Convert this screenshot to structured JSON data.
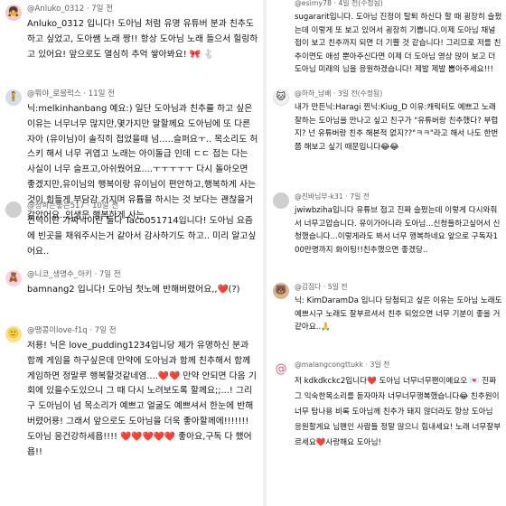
{
  "left_column": {
    "comments": [
      {
        "author": "@Anluko_0312",
        "time": "7일 전",
        "avatar_icon": "girl-avatar-icon",
        "text": "Anluko_0312 입니다! 도아님 처럼 유명 유튜버 분과 친추도 하고 싶었고, 도아쌤 노래 짱!! 항상 도아님 노래 들으서 힐링하고 있어요! 앞으로도 열심히 추억 쌓아봐요! 🎀 🐇"
      },
      {
        "author": "@뭐야_로블럭스",
        "time": "11일 전",
        "avatar_icon": "character-avatar-icon",
        "text": "닉:melkinhanbang 예요:) 일단 도아님과 친추를 하고 싶은 이유는 너무너무 많지만,몇가지만 말할께요 도아님에 또 다른 자아 (유이님)이 솔직히 접었을때 넘.....슬퍼요ㅜ.. 목소리도 허스키 해서 너무 귀엽고 노래는 아이돌급 인데 ㄷㄷ 접는 다는 사실이 너무 슬프고,아쉬웠어요....ㅜㅜㅜㅜㅜ 다시 돌아오면 좋겠지만,유이님의 행복이랑 유이님이 편안하고,행복하게 사는 것이 힘들게 부담감 가지며 유튭을 하시는 것 보다는 괜찮을거 같았어요..인생은 행복하게 사는"
      },
      {
        "author": "@정희는좋은517",
        "time": "10일 전",
        "avatar_icon": "gray-avatar-icon",
        "text": "찐닉이란 가짜닉이란 둘다 Taco051714입니다! 도아님 요즘에 빈곳을 채워주시는거 같아서 감사하기도 하고.. 미리 알고싶어요.."
      },
      {
        "author": "@니코_생명수_아키",
        "time": "7일 전",
        "avatar_icon": "pink-character-avatar-icon",
        "text": "bamnang2 입니다! 도아님 첫노에 반해버렸어요,,❤️(?)"
      },
      {
        "author": "@땡콩이love-f1q",
        "time": "7일 전",
        "avatar_icon": "shinchan-avatar-icon",
        "text": "저용! 닉은 love_pudding1234입니당 제가 유명하신 분과 함께 게임을 하구싶은데 만약에 도아님과 함께 친추해서 함께 게임하면 정말루 행복할것같네염....❤️❤️ 만약 안되면 다음 기회에 있을수도있으니 그 때 다시 노려보도록 할께요;;...! 그리구 도아님이 넘 목소리가 예쁘고 얼굴도 예쁘셔서 한눈에 반해버렸어용! 그래서 앞으로도 도아님을 더욱 좋아할께에!!!!!!! 도아님 응건강하세욥!!!! ❤️❤️❤️❤️❤️ 좋아요,구독 다 했어욥!!"
      }
    ]
  },
  "right_column": {
    "comments": [
      {
        "author": "@esimy78",
        "time": "4일 전(수정됨)",
        "avatar_icon": "none",
        "text": "sugararit입니다. 도아님 진정이 탈퇴 하신다 할 때 굉장히 슬펐는데 이렇게 또 보고 있어서 굉장히 기쁩니다.이제 도아님 채널 접이 보고 친추까지 되면 더 기쁠 것 같습니다! 그리므로 저를 친추이면도 애성 뿐아주신다면 이제 더 도아님 영상 많이 보고 더 도아님 미래의 님을 응원하겠습니다! 제발 제발 뽑아주세요!!!"
      },
      {
        "author": "@하하_남배",
        "time": "3일 전(수정됨)",
        "avatar_icon": "white-cat-avatar-icon",
        "text": "내가 만든닉:Haragi 찐닉:Kiug_D 이유:캐릭터도 예쁘고 노래 잘하는 도아님을 만나고 싶고 친구가 \"유튜버랑 친추했다? 부럽지? 넌 유튜버랑 친추 해본적 없지??\"ㅋㅋ\"라고 해서 나도 한번쯤 해보고 싶기 때문입니다😂😂"
      },
      {
        "author": "@진바님부-k31",
        "time": "7일 전",
        "avatar_icon": "gray-avatar-icon",
        "text": "jwiwbziha입니다 유튜브 접고 진짜 슬펐는데 이렇게 다시와줘서 너무고맙습니다. 유이가아니라 도아님...신청들하고싶어서 신청했습니다...이렇게라도 봐서 너무 행복하네요 앞으로 구독자100만명까지 화이팅!!친추했으면 좋겠당.."
      },
      {
        "author": "@김점다",
        "time": "5일 전",
        "avatar_icon": "bear-avatar-icon",
        "text": "닉: KimDaramDa 입니다 당첨되고 싶은 이유는 도아님 노래도 예쁘시구 노래도 잘부르셔서 친추 되었으면 너무 기분이 좋을 거 같아요..🙏"
      },
      {
        "author": "@malangcongttukk",
        "time": "3일 전",
        "avatar_icon": "pink-spiral-avatar-icon",
        "text": "저 kdkdkckc2입니다❤️ 도아님 너무너무팬이예요오 💌 진짜 그 익숙한목소리를 듣자마자 너무너무행복했습니다😂 친추원이너무 탐나용 비록 도아님께 친추가 돼지 않더라도 항상 도아님 응원할게요 님팬인 사람들 정말 많으니 힘내세요! 노래 너무잘부르세요❤️사랑해요 도아님!"
      }
    ]
  },
  "colors": {
    "heart": "#e0202a",
    "meta_gray": "#606060",
    "text": "#0f0f0f"
  }
}
